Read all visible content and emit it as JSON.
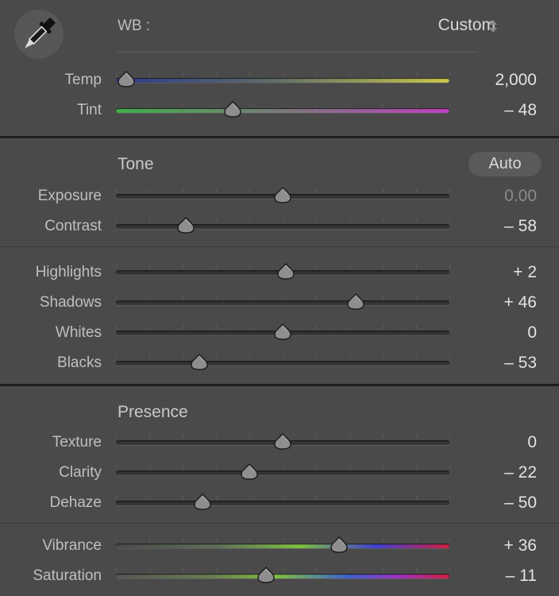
{
  "wb": {
    "label": "WB :",
    "value": "Custom"
  },
  "icons": {
    "eyedropper": "eyedropper-icon",
    "spinner": "up-down-spinner-icon"
  },
  "wb_sliders": [
    {
      "label": "Temp",
      "value": "2,000",
      "fraction": 0.03
    },
    {
      "label": "Tint",
      "value": "– 48",
      "fraction": 0.35
    }
  ],
  "tone": {
    "title": "Tone",
    "auto_label": "Auto",
    "sliders": [
      {
        "label": "Exposure",
        "value": "0.00",
        "fraction": 0.5
      },
      {
        "label": "Contrast",
        "value": "– 58",
        "fraction": 0.21
      },
      {
        "label": "Highlights",
        "value": "+ 2",
        "fraction": 0.51
      },
      {
        "label": "Shadows",
        "value": "+ 46",
        "fraction": 0.72
      },
      {
        "label": "Whites",
        "value": "0",
        "fraction": 0.5
      },
      {
        "label": "Blacks",
        "value": "– 53",
        "fraction": 0.25
      }
    ]
  },
  "presence": {
    "title": "Presence",
    "sliders": [
      {
        "label": "Texture",
        "value": "0",
        "fraction": 0.5
      },
      {
        "label": "Clarity",
        "value": "– 22",
        "fraction": 0.4
      },
      {
        "label": "Dehaze",
        "value": "– 50",
        "fraction": 0.26
      },
      {
        "label": "Vibrance",
        "value": "+ 36",
        "fraction": 0.67
      },
      {
        "label": "Saturation",
        "value": "– 11",
        "fraction": 0.45
      }
    ]
  },
  "colors": {
    "panel_bg": "#4a4a4a",
    "temp_gradient": [
      "#2f3a8c",
      "#c8c64a"
    ],
    "tint_gradient": [
      "#3fb04a",
      "#c040c0"
    ],
    "vibrance_gradient": [
      "#5a6a5a",
      "#7fbf3f",
      "#4040d0",
      "#d02040"
    ]
  }
}
